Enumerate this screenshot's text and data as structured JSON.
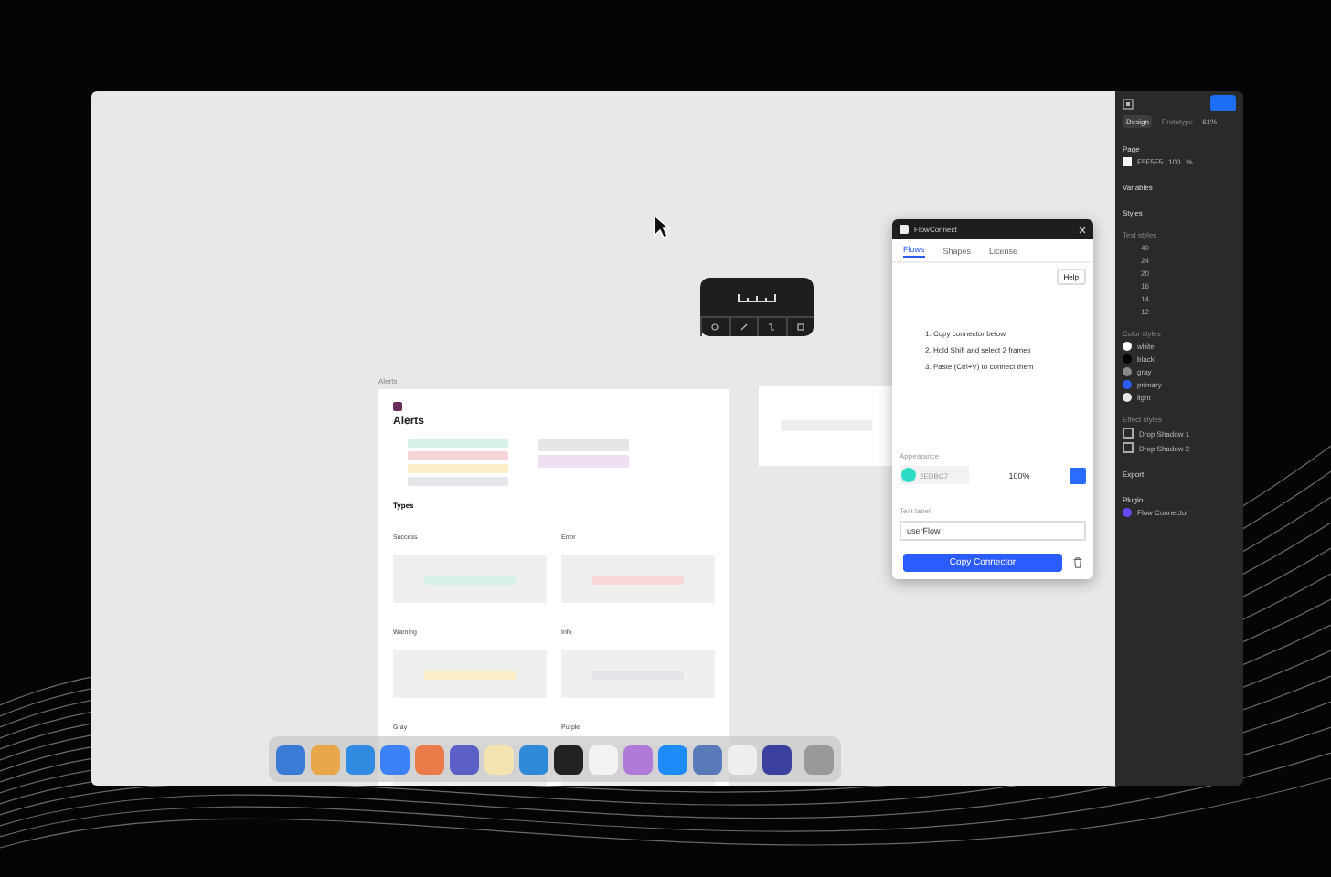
{
  "panel": {
    "tabs": [
      {
        "label": "Design",
        "selected": true
      },
      {
        "label": "Prototype",
        "selected": false
      }
    ],
    "zoom": "61%",
    "page_label": "Page",
    "page_color": "F5F5F5",
    "page_opacity": "100",
    "page_unit": "%",
    "variables": "Variables",
    "styles": "Styles",
    "text_styles_label": "Text styles",
    "text_styles": [
      "40",
      "24",
      "20",
      "16",
      "14",
      "12"
    ],
    "color_styles_label": "Color styles",
    "color_styles": [
      {
        "name": "white",
        "color": "#ffffff"
      },
      {
        "name": "black",
        "color": "#000000"
      },
      {
        "name": "gray",
        "color": "#8a8a8a"
      },
      {
        "name": "primary",
        "color": "#2b5cff"
      },
      {
        "name": "light",
        "color": "#e6e6e6"
      }
    ],
    "effect_styles_label": "Effect styles",
    "effect_styles": [
      "Drop Shadow 1",
      "Drop Shadow 2"
    ],
    "export": "Export",
    "plugin_label": "Plugin",
    "plugin": "Flow Connector"
  },
  "plugin_window": {
    "title": "FlowConnect",
    "tabs": [
      {
        "label": "Flows",
        "selected": true
      },
      {
        "label": "Shapes",
        "selected": false
      },
      {
        "label": "License",
        "selected": false
      }
    ],
    "help": "Help",
    "steps": [
      "1. Copy connector below",
      "2. Hold Shift and select 2 frames",
      "3. Paste (Ctrl+V) to connect them"
    ],
    "appearance": "Appearance",
    "color": "#2edbc7",
    "hex": "2EDBC7",
    "opacity": "100%",
    "text_label": "Text label",
    "label_value": "userFlow",
    "button": "Copy Connector"
  },
  "frames": [
    {
      "label": "Alerts",
      "title": "Alerts",
      "types": "Types",
      "sections": [
        {
          "name": "Success",
          "color": "#d8f0ea"
        },
        {
          "name": "Error",
          "color": "#f6d6d6"
        },
        {
          "name": "Warning",
          "color": "#fbefc8"
        },
        {
          "name": "Info",
          "color": "#e4e6ea"
        },
        {
          "name": "Gray",
          "color": "#e6e6e6"
        },
        {
          "name": "Purple",
          "color": "#efdff3"
        }
      ]
    }
  ]
}
